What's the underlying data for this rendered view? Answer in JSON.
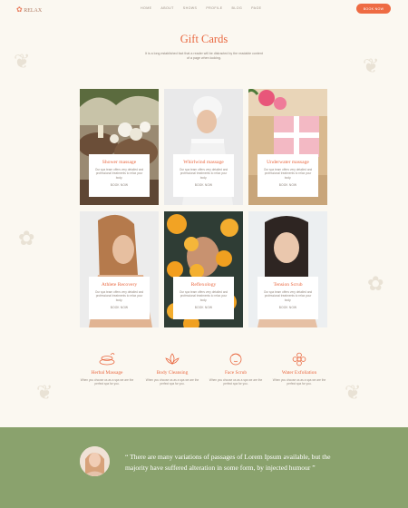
{
  "header": {
    "logo_text": "RELAX",
    "nav": [
      "HOME",
      "ABOUT",
      "SHOWS",
      "PROFILE",
      "BLOG",
      "PAGE"
    ],
    "cta": "BOOK NOW"
  },
  "hero": {
    "title": "Gift Cards",
    "intro": "It is a long established fact that a reader will be distracted by the readable content of a page when looking."
  },
  "cards": [
    {
      "title": "Shower massage",
      "text": "Our spa team offers very detailed and professional treatments to relax your body.",
      "link": "BOOK NOW"
    },
    {
      "title": "Whirlwind massage",
      "text": "Our spa team offers very detailed and professional treatments to relax your body.",
      "link": "BOOK NOW"
    },
    {
      "title": "Underwater massage",
      "text": "Our spa team offers very detailed and professional treatments to relax your body.",
      "link": "BOOK NOW"
    },
    {
      "title": "Athlete Recovery",
      "text": "Our spa team offers very detailed and professional treatments to relax your body.",
      "link": "BOOK NOW"
    },
    {
      "title": "Reflexology",
      "text": "Our spa team offers very detailed and professional treatments to relax your body.",
      "link": "BOOK NOW"
    },
    {
      "title": "Tension Scrub",
      "text": "Our spa team offers very detailed and professional treatments to relax your body.",
      "link": "BOOK NOW"
    }
  ],
  "features": [
    {
      "title": "Herbal Massage",
      "text": "When you choose us as a spa we are the perfect spa for you."
    },
    {
      "title": "Body Cleansing",
      "text": "When you choose us as a spa we are the perfect spa for you."
    },
    {
      "title": "Face Scrub",
      "text": "When you choose us as a spa we are the perfect spa for you."
    },
    {
      "title": "Water Exfoliation",
      "text": "When you choose us as a spa we are the perfect spa for you."
    }
  ],
  "testimonial": {
    "quote": "“ There are many variations of passages of Lorem Ipsum available, but the majority have suffered alteration in some form, by injected humour ”"
  },
  "colors": {
    "accent": "#ee6b43",
    "heading": "#e9673f",
    "testimonial_bg": "#8aa26d",
    "page_bg": "#fbf8f1"
  }
}
